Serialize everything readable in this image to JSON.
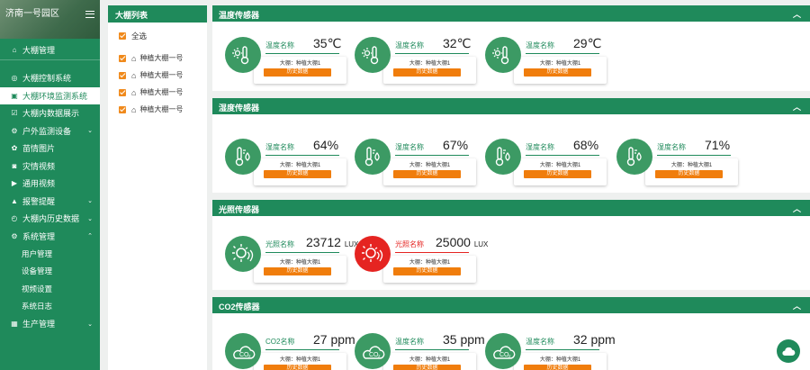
{
  "sidebar": {
    "park": "济南一号园区",
    "top_item": "大棚管理",
    "items": [
      {
        "label": "大棚控制系统",
        "icon": "target-icon",
        "chev": ""
      },
      {
        "label": "大棚环境监测系统",
        "icon": "monitor-icon",
        "chev": "",
        "active": true
      },
      {
        "label": "大棚内数据展示",
        "icon": "check-box-icon",
        "chev": ""
      },
      {
        "label": "户外监测设备",
        "icon": "gear-icon",
        "chev": "⌄"
      },
      {
        "label": "苗情图片",
        "icon": "sprout-icon",
        "chev": ""
      },
      {
        "label": "灾情视频",
        "icon": "camera-icon",
        "chev": ""
      },
      {
        "label": "通用视频",
        "icon": "video-icon",
        "chev": ""
      },
      {
        "label": "报警提醒",
        "icon": "warning-icon",
        "chev": "⌄"
      },
      {
        "label": "大棚内历史数据",
        "icon": "history-icon",
        "chev": "⌄"
      },
      {
        "label": "系统管理",
        "icon": "settings-icon",
        "chev": "⌃"
      }
    ],
    "subitems": [
      "用户管理",
      "设备管理",
      "视频设置",
      "系统日志"
    ],
    "bottom_item": {
      "label": "生产管理",
      "chev": "⌄"
    }
  },
  "greenhouse_list": {
    "title": "大棚列表",
    "select_all": "全选",
    "items": [
      "种植大棚一号",
      "种植大棚一号",
      "种植大棚一号",
      "种植大棚一号"
    ]
  },
  "sections": [
    {
      "title": "温度传感器",
      "cards": [
        {
          "label": "温度名称",
          "value": "35℃",
          "unit": "",
          "greenhouse": "大棚：种植大棚1",
          "button": "历史数据",
          "icon": "thermometer-sun-icon",
          "alert": false
        },
        {
          "label": "温度名称",
          "value": "32℃",
          "unit": "",
          "greenhouse": "大棚：种植大棚1",
          "button": "历史数据",
          "icon": "thermometer-sun-icon",
          "alert": false
        },
        {
          "label": "温度名称",
          "value": "29℃",
          "unit": "",
          "greenhouse": "大棚：种植大棚1",
          "button": "历史数据",
          "icon": "thermometer-sun-icon",
          "alert": false
        }
      ]
    },
    {
      "title": "湿度传感器",
      "cards": [
        {
          "label": "湿度名称",
          "value": "64%",
          "unit": "",
          "greenhouse": "大棚：种植大棚1",
          "button": "历史数据",
          "icon": "humidity-icon",
          "alert": false
        },
        {
          "label": "湿度名称",
          "value": "67%",
          "unit": "",
          "greenhouse": "大棚：种植大棚1",
          "button": "历史数据",
          "icon": "humidity-icon",
          "alert": false
        },
        {
          "label": "湿度名称",
          "value": "68%",
          "unit": "",
          "greenhouse": "大棚：种植大棚1",
          "button": "历史数据",
          "icon": "humidity-icon",
          "alert": false
        },
        {
          "label": "湿度名称",
          "value": "71%",
          "unit": "",
          "greenhouse": "大棚：种植大棚1",
          "button": "历史数据",
          "icon": "humidity-icon",
          "alert": false
        }
      ]
    },
    {
      "title": "光照传感器",
      "cards": [
        {
          "label": "光照名称",
          "value": "23712",
          "unit": "LUX",
          "greenhouse": "大棚：种植大棚1",
          "button": "历史数据",
          "icon": "sun-icon",
          "alert": false
        },
        {
          "label": "光照名称",
          "value": "25000",
          "unit": "LUX",
          "greenhouse": "大棚：种植大棚1",
          "button": "历史数据",
          "icon": "sun-icon",
          "alert": true
        }
      ]
    },
    {
      "title": "CO2传感器",
      "cards": [
        {
          "label": "CO2名称",
          "value": "27 ppm",
          "unit": "",
          "greenhouse": "大棚：种植大棚1",
          "button": "历史数据",
          "icon": "co2-cloud-icon",
          "alert": false
        },
        {
          "label": "温度名称",
          "value": "35 ppm",
          "unit": "",
          "greenhouse": "大棚：种植大棚1",
          "button": "历史数据",
          "icon": "co2-cloud-icon",
          "alert": false
        },
        {
          "label": "温度名称",
          "value": "32 ppm",
          "unit": "",
          "greenhouse": "大棚：种植大棚1",
          "button": "历史数据",
          "icon": "co2-cloud-icon",
          "alert": false
        }
      ]
    }
  ],
  "colors": {
    "primary": "#1f8a5b",
    "accent": "#f07d0c",
    "alert": "#e52421",
    "icon_bg": "#3c9a64"
  }
}
